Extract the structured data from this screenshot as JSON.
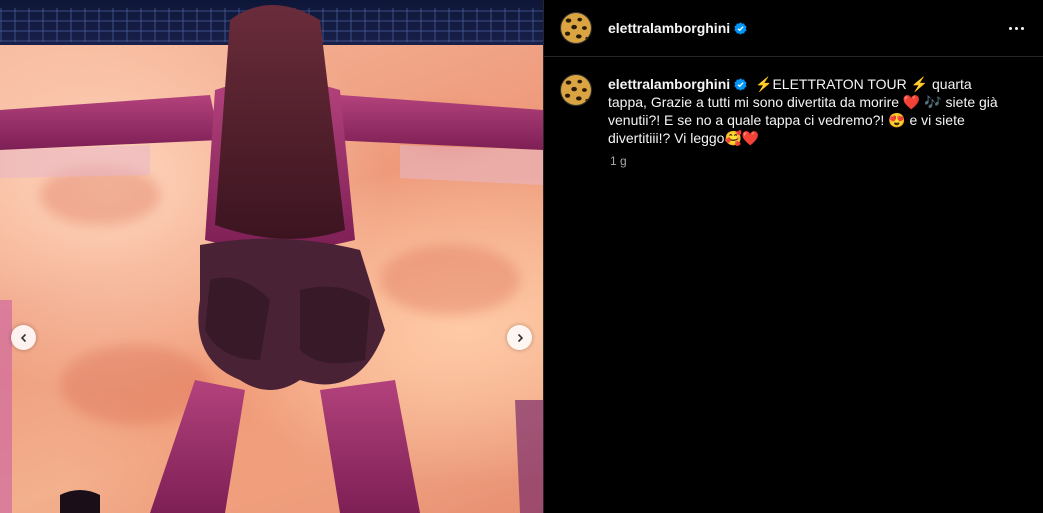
{
  "post": {
    "username": "elettralamborghini",
    "verified": true,
    "more_icon": "more-horizontal-icon"
  },
  "caption": {
    "username": "elettralamborghini",
    "text": "⚡️ELETTRATON TOUR ⚡️ quarta tappa, Grazie a tutti mi sono divertita da morire ❤️ 🎶 siete già venutii?! E se no a quale tappa ci vedremo?! 😍 e vi siete divertitiii!? Vi leggo🥰❤️",
    "timestamp": "1 g"
  },
  "media": {
    "prev_icon": "chevron-left-icon",
    "next_icon": "chevron-right-icon"
  },
  "colors": {
    "background": "#000000",
    "text": "#f5f5f5",
    "secondary_text": "#a8a8a8",
    "verified_badge": "#0095f6",
    "divider": "#262626"
  }
}
